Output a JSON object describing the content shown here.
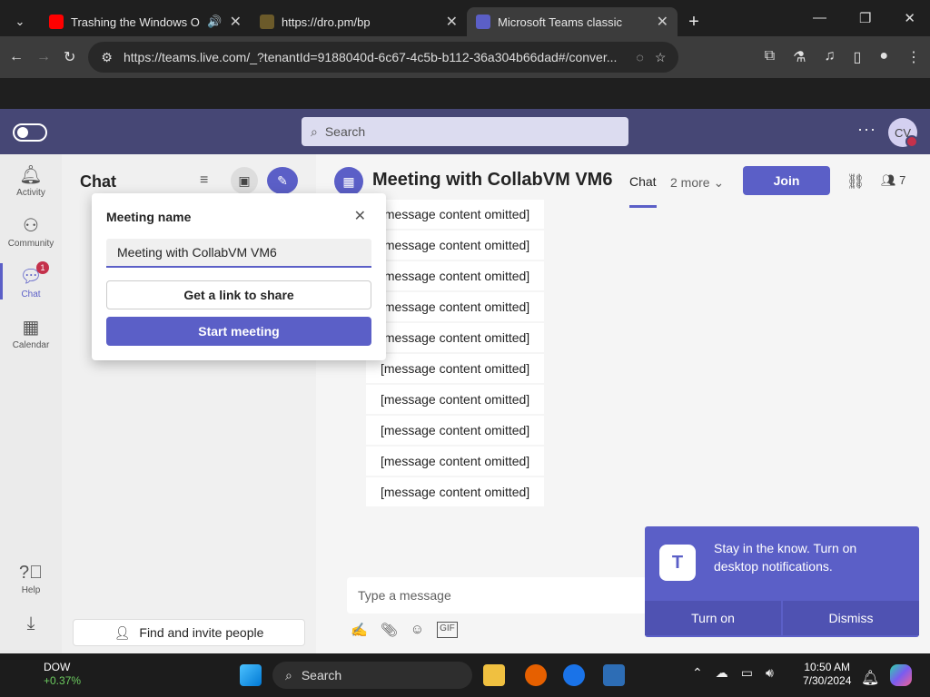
{
  "browser": {
    "tabs": [
      {
        "title": "Trashing the Windows OO",
        "favicon_color": "#ff0000"
      },
      {
        "title": "https://dro.pm/bp",
        "favicon_color": "#6b5a2a"
      },
      {
        "title": "Microsoft Teams classic",
        "favicon_color": "#5b5fc7"
      }
    ],
    "url": "https://teams.live.com/_?tenantId=9188040d-6c67-4c5b-b112-36a304b66dad#/conver..."
  },
  "teams": {
    "search_placeholder": "Search",
    "avatar_initials": "CV",
    "rail": [
      {
        "label": "Activity",
        "icon": "bell-icon"
      },
      {
        "label": "Community",
        "icon": "community-icon"
      },
      {
        "label": "Chat",
        "icon": "chat-icon",
        "badge": "1"
      },
      {
        "label": "Calendar",
        "icon": "calendar-icon"
      },
      {
        "label": "Help",
        "icon": "help-icon"
      }
    ],
    "chat_panel": {
      "title": "Chat",
      "invite_label": "Find and invite people"
    },
    "meet_popup": {
      "label": "Meeting name",
      "input_value": "Meeting with CollabVM VM6",
      "link_button": "Get a link to share",
      "start_button": "Start meeting"
    },
    "conversation": {
      "title": "Meeting with CollabVM VM6",
      "tab": "Chat",
      "more": "2 more",
      "join": "Join",
      "participants": "7",
      "messages": [
        "[message content omitted]",
        "[message content omitted]",
        "[message content omitted]",
        "[message content omitted]",
        "[message content omitted]",
        "[message content omitted]",
        "[message content omitted]",
        "[message content omitted]",
        "[message content omitted]",
        "[message content omitted]"
      ],
      "composer_placeholder": "Type a message"
    },
    "toast": {
      "text": "Stay in the know. Turn on desktop notifications.",
      "turn_on": "Turn on",
      "dismiss": "Dismiss"
    }
  },
  "taskbar": {
    "stock_name": "DOW",
    "stock_change": "+0.37%",
    "search_label": "Search",
    "time": "10:50 AM",
    "date": "7/30/2024"
  }
}
